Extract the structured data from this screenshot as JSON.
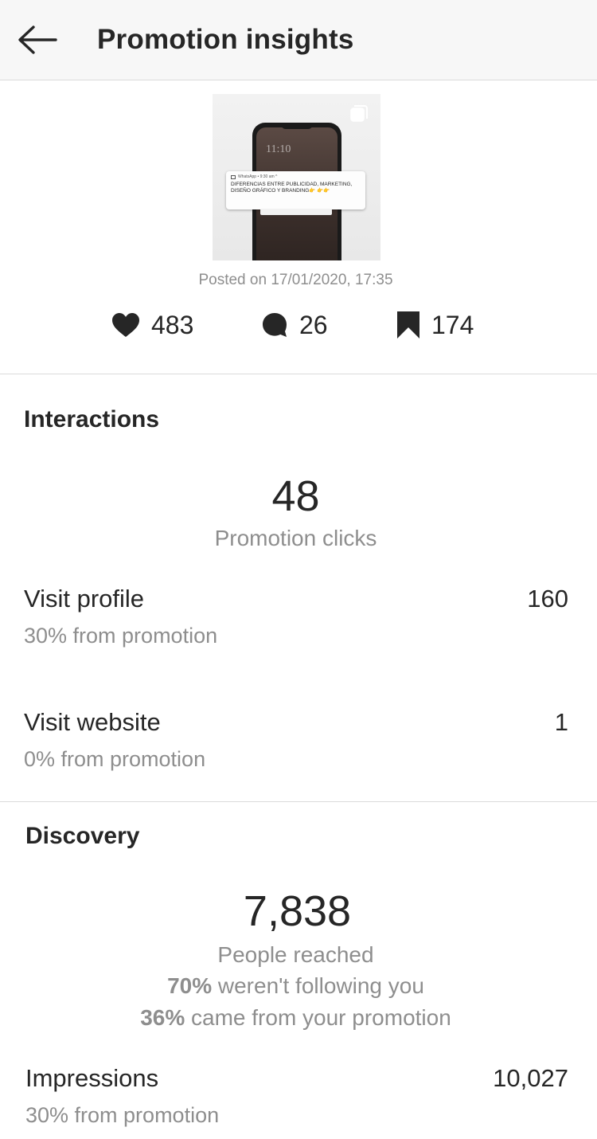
{
  "header": {
    "title": "Promotion insights",
    "back_icon": "arrow-left-icon"
  },
  "post": {
    "preview": {
      "phone_time": "11:10",
      "notification_app": "WhatsApp • 9:30 am ^",
      "notification_line1": "DIFERENCIAS ENTRE PUBLICIDAD, MARKETING,",
      "notification_line2": "DISEÑO GRÁFICO Y BRANDING👉 👉👉"
    },
    "posted_on": "Posted on 17/01/2020, 17:35",
    "likes": "483",
    "comments": "26",
    "saves": "174"
  },
  "interactions": {
    "title": "Interactions",
    "clicks_value": "48",
    "clicks_label": "Promotion clicks",
    "visit_profile": {
      "label": "Visit profile",
      "value": "160",
      "sub": "30% from promotion"
    },
    "visit_website": {
      "label": "Visit website",
      "value": "1",
      "sub": "0% from promotion"
    }
  },
  "discovery": {
    "title": "Discovery",
    "reached_value": "7,838",
    "reached_label": "People reached",
    "not_following_pct": "70%",
    "not_following_text": " weren't following you",
    "from_promo_pct": "36%",
    "from_promo_text": " came from your promotion",
    "impressions": {
      "label": "Impressions",
      "value": "10,027",
      "sub": "30% from promotion"
    }
  },
  "colors": {
    "text_primary": "#262626",
    "text_secondary": "#8e8e8e",
    "divider": "#dbdbdb",
    "header_bg": "#f7f7f7"
  }
}
